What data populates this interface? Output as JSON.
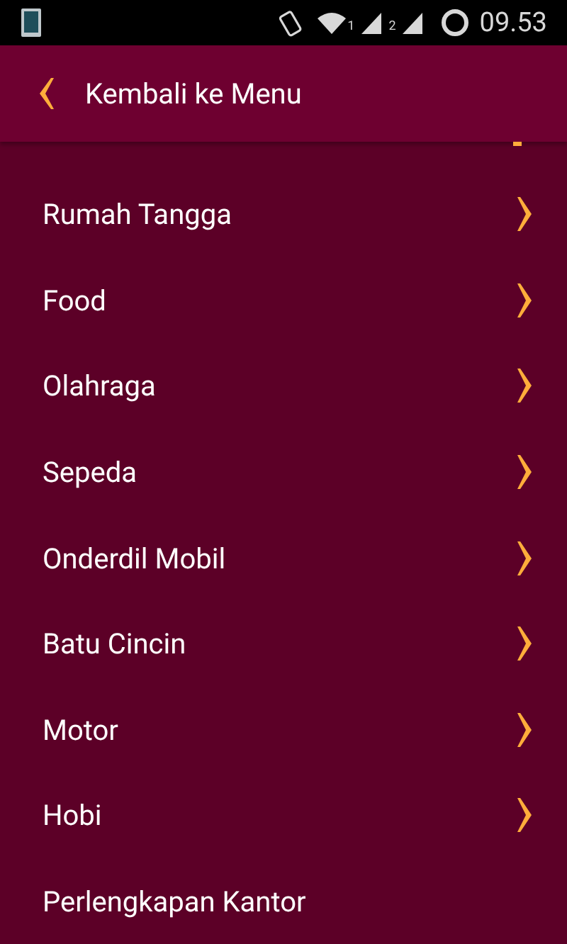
{
  "status_bar": {
    "sim_labels": [
      "1",
      "2"
    ],
    "time": "09.53"
  },
  "header": {
    "title": "Kembali ke Menu"
  },
  "items": [
    {
      "label": "Rumah Tangga",
      "arrow": true
    },
    {
      "label": "Food",
      "arrow": true
    },
    {
      "label": "Olahraga",
      "arrow": true
    },
    {
      "label": "Sepeda",
      "arrow": true
    },
    {
      "label": "Onderdil Mobil",
      "arrow": true
    },
    {
      "label": "Batu Cincin",
      "arrow": true
    },
    {
      "label": "Motor",
      "arrow": true
    },
    {
      "label": "Hobi",
      "arrow": true
    },
    {
      "label": "Perlengkapan Kantor",
      "arrow": false
    }
  ]
}
